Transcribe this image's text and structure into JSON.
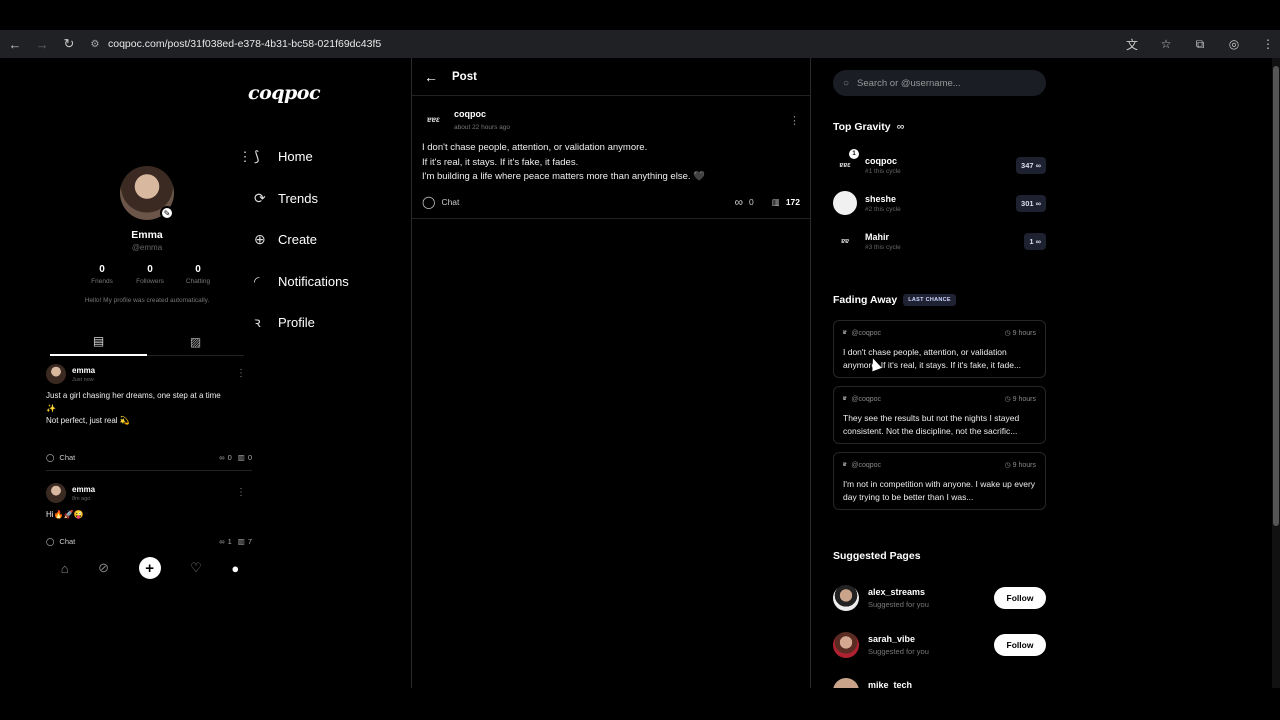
{
  "browser": {
    "url": "coqpoc.com/post/31f038ed-e378-4b31-bc58-021f69dc43f5"
  },
  "brand": "coqpoc",
  "nav": {
    "items": [
      {
        "label": "Home",
        "icon": "home-icon"
      },
      {
        "label": "Trends",
        "icon": "trends-icon"
      },
      {
        "label": "Create",
        "icon": "create-icon"
      },
      {
        "label": "Notifications",
        "icon": "notifications-icon"
      },
      {
        "label": "Profile",
        "icon": "profile-icon"
      }
    ]
  },
  "profile": {
    "name": "Emma",
    "handle": "@emma",
    "stats": [
      {
        "value": "0",
        "label": "Friends"
      },
      {
        "value": "0",
        "label": "Followers"
      },
      {
        "value": "0",
        "label": "Chatting"
      }
    ],
    "bio": "Hello! My profile was created automatically.",
    "posts": [
      {
        "user": "emma",
        "time": "Just now",
        "text_line1": "Just a girl chasing her dreams, one step at a time",
        "text_line2": "✨",
        "text_line3": "Not perfect, just real 💫",
        "chat_label": "Chat",
        "infinity_count": "0",
        "views": "0"
      },
      {
        "user": "emma",
        "time": "8m ago",
        "text_line1": "Hi🔥🚀😜",
        "chat_label": "Chat",
        "infinity_count": "1",
        "views": "7"
      }
    ]
  },
  "post": {
    "header_title": "Post",
    "user": "coqpoc",
    "time": "about 22 hours ago",
    "line1": "I don't chase people, attention, or validation anymore.",
    "line2": "If it's real, it stays. If it's fake, it fades.",
    "line3": "I'm building a life where peace matters more than anything else. 🖤",
    "chat_label": "Chat",
    "infinity_count": "0",
    "views": "172"
  },
  "search": {
    "placeholder": "Search or @username..."
  },
  "top_gravity": {
    "title": "Top Gravity",
    "items": [
      {
        "name": "coqpoc",
        "sub": "#1 this cycle",
        "score": "347 ∞"
      },
      {
        "name": "sheshe",
        "sub": "#2 this cycle",
        "score": "301 ∞"
      },
      {
        "name": "Mahir",
        "sub": "#3 this cycle",
        "score": "1 ∞"
      }
    ]
  },
  "fading_away": {
    "title": "Fading Away",
    "badge": "LAST CHANCE",
    "items": [
      {
        "user": "@coqpoc",
        "time": "9 hours",
        "text": "I don't chase people, attention, or validation anymore. If it's real, it stays. If it's fake, it fade..."
      },
      {
        "user": "@coqpoc",
        "time": "9 hours",
        "text": "They see the results but not the nights I stayed consistent. Not the discipline, not the sacrific..."
      },
      {
        "user": "@coqpoc",
        "time": "9 hours",
        "text": "I'm not in competition with anyone. I wake up every day trying to be better than I was..."
      }
    ]
  },
  "suggested": {
    "title": "Suggested Pages",
    "items": [
      {
        "name": "alex_streams",
        "sub": "Suggested for you",
        "button": "Follow"
      },
      {
        "name": "sarah_vibe",
        "sub": "Suggested for you",
        "button": "Follow"
      },
      {
        "name": "mike_tech",
        "sub": "",
        "button": ""
      }
    ]
  },
  "colors": {
    "background": "#000000",
    "browser_bar": "#202124",
    "badge_bg": "#1e2233"
  }
}
